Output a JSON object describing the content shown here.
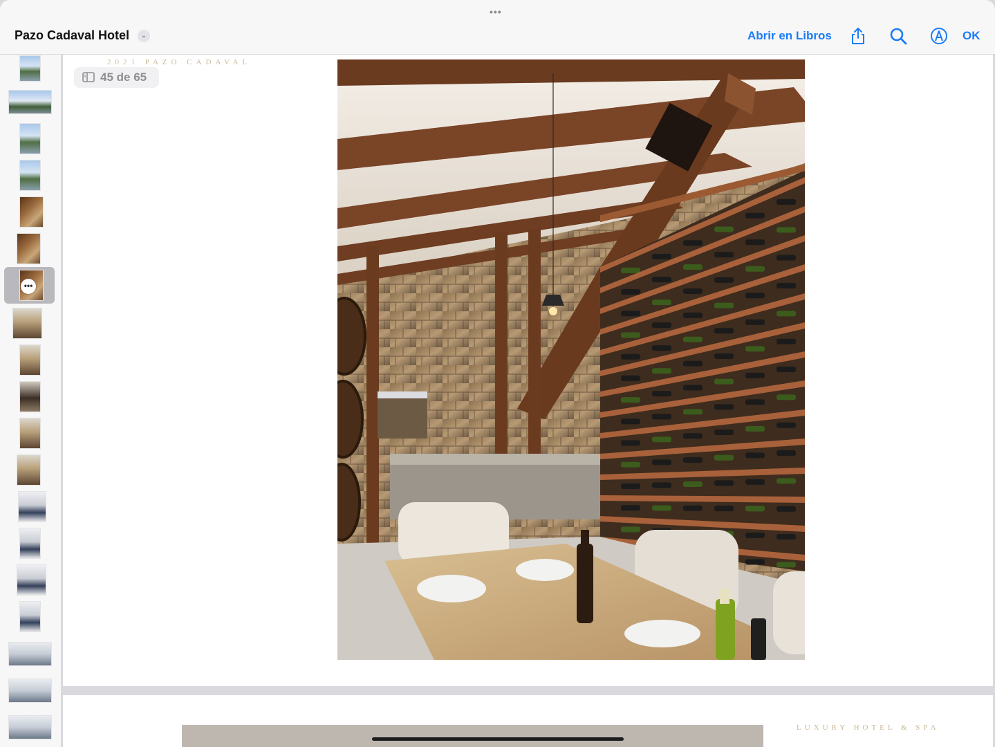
{
  "header": {
    "title": "Pazo Cadaval Hotel",
    "grabber": "•••",
    "open_in_books": "Abrir en Libros",
    "done": "OK",
    "icons": [
      "share-icon",
      "search-icon",
      "markup-icon"
    ],
    "accent": "#1a7cf5"
  },
  "document": {
    "brand_top": "2021 PAZO CADAVAL",
    "page_indicator": "45 de 65",
    "brand_bottom": "LUXURY HOTEL & SPA"
  },
  "sidebar": {
    "selected_index": 6,
    "more_badge": "•••"
  }
}
